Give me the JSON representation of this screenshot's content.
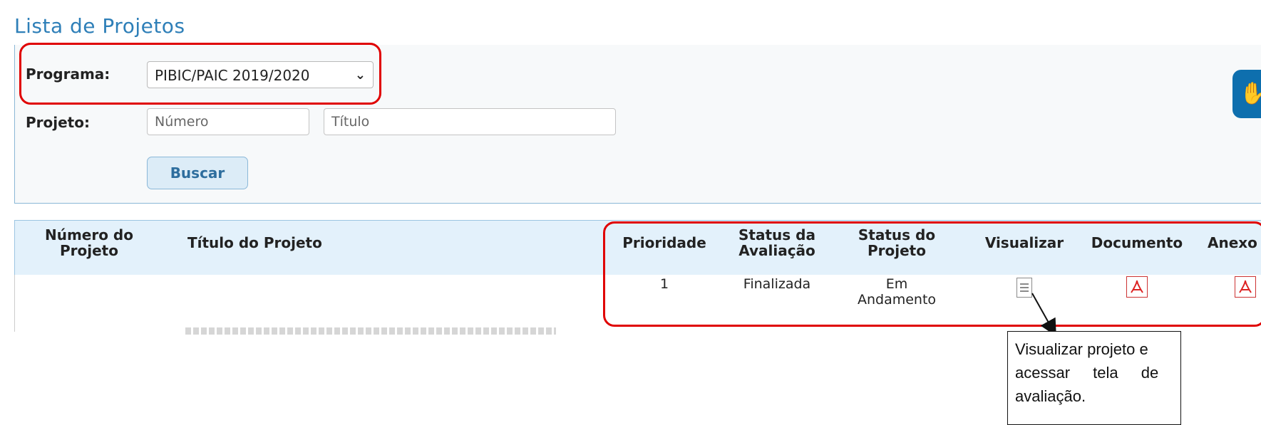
{
  "page": {
    "title": "Lista de Projetos"
  },
  "filters": {
    "programa_label": "Programa:",
    "programa_value": "PIBIC/PAIC 2019/2020",
    "projeto_label": "Projeto:",
    "numero_placeholder": "Número",
    "titulo_placeholder": "Título",
    "search_button": "Buscar"
  },
  "accessibility": {
    "icon": "sign-language-hand-icon"
  },
  "table": {
    "headers": {
      "numero": [
        "Número do",
        "Projeto"
      ],
      "titulo": "Título do Projeto",
      "prioridade": "Prioridade",
      "status_avaliacao": [
        "Status da",
        "Avaliação"
      ],
      "status_projeto": [
        "Status do",
        "Projeto"
      ],
      "visualizar": "Visualizar",
      "documento": "Documento",
      "anexo": "Anexo"
    },
    "rows": [
      {
        "prioridade": "1",
        "status_avaliacao": "Finalizada",
        "status_projeto": [
          "Em",
          "Andamento"
        ],
        "visualizar_icon": "document-view-icon",
        "documento_icon": "pdf-icon",
        "anexo_icon": "pdf-icon"
      }
    ]
  },
  "annotation": {
    "callout_lines": [
      "Visualizar projeto e",
      "acessar tela de",
      "avaliação."
    ],
    "highlight_color": "#e00000"
  }
}
